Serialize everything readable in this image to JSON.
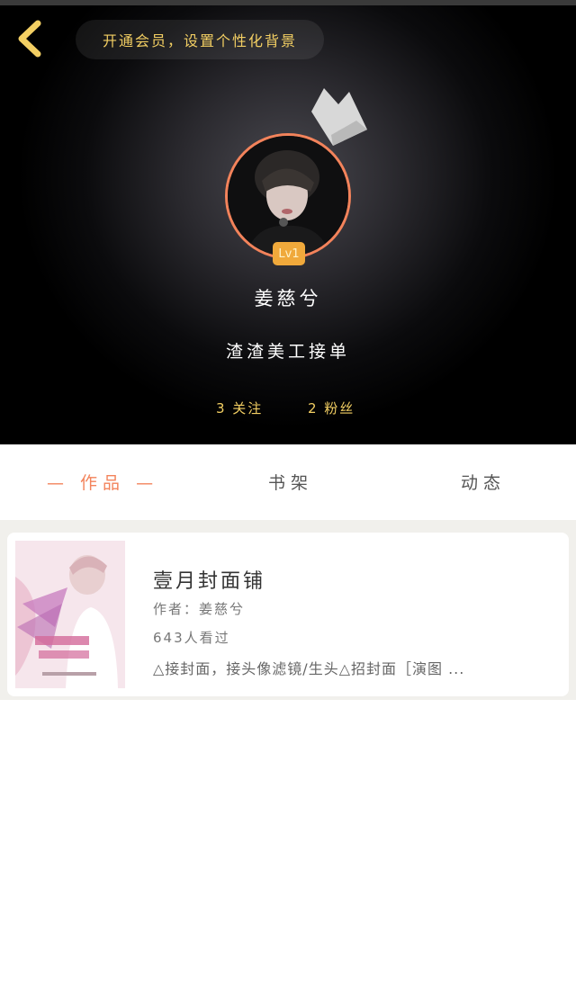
{
  "header": {
    "vip_banner": "开通会员，设置个性化背景"
  },
  "profile": {
    "level": "Lv1",
    "username": "姜慈兮",
    "bio": "渣渣美工接单",
    "following": "3 关注",
    "followers": "2 粉丝"
  },
  "tabs": [
    {
      "label": "— 作品 —",
      "active": true
    },
    {
      "label": "书架",
      "active": false
    },
    {
      "label": "动态",
      "active": false
    }
  ],
  "works": [
    {
      "title": "壹月封面铺",
      "author": "作者：姜慈兮",
      "views": "643人看过",
      "description": "△接封面，接头像滤镜/生头△招封面［演图 ..."
    }
  ],
  "colors": {
    "accent": "#f3835b",
    "gold": "#f3cf63",
    "badge": "#f0a93b"
  },
  "icons": {
    "back": "chevron-left-icon",
    "crown": "crown-icon"
  }
}
